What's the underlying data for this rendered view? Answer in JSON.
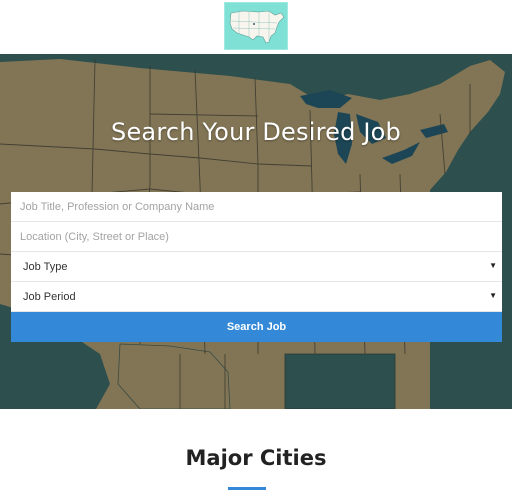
{
  "logo": {
    "icon": "usa-map-icon",
    "color": "#7fe0d6"
  },
  "hero": {
    "title": "Search Your Desired Job",
    "background_icon": "usa-map-background",
    "colors": {
      "land": "#8b7d5b",
      "water": "#2f5452",
      "lakes": "#1d4a5c"
    }
  },
  "search_form": {
    "job_title_placeholder": "Job Title, Profession or Company Name",
    "location_placeholder": "Location (City, Street or Place)",
    "job_type_label": "Job Type",
    "job_period_label": "Job Period",
    "submit_label": "Search Job",
    "accent_color": "#3389d8"
  },
  "major_cities": {
    "title": "Major Cities"
  }
}
